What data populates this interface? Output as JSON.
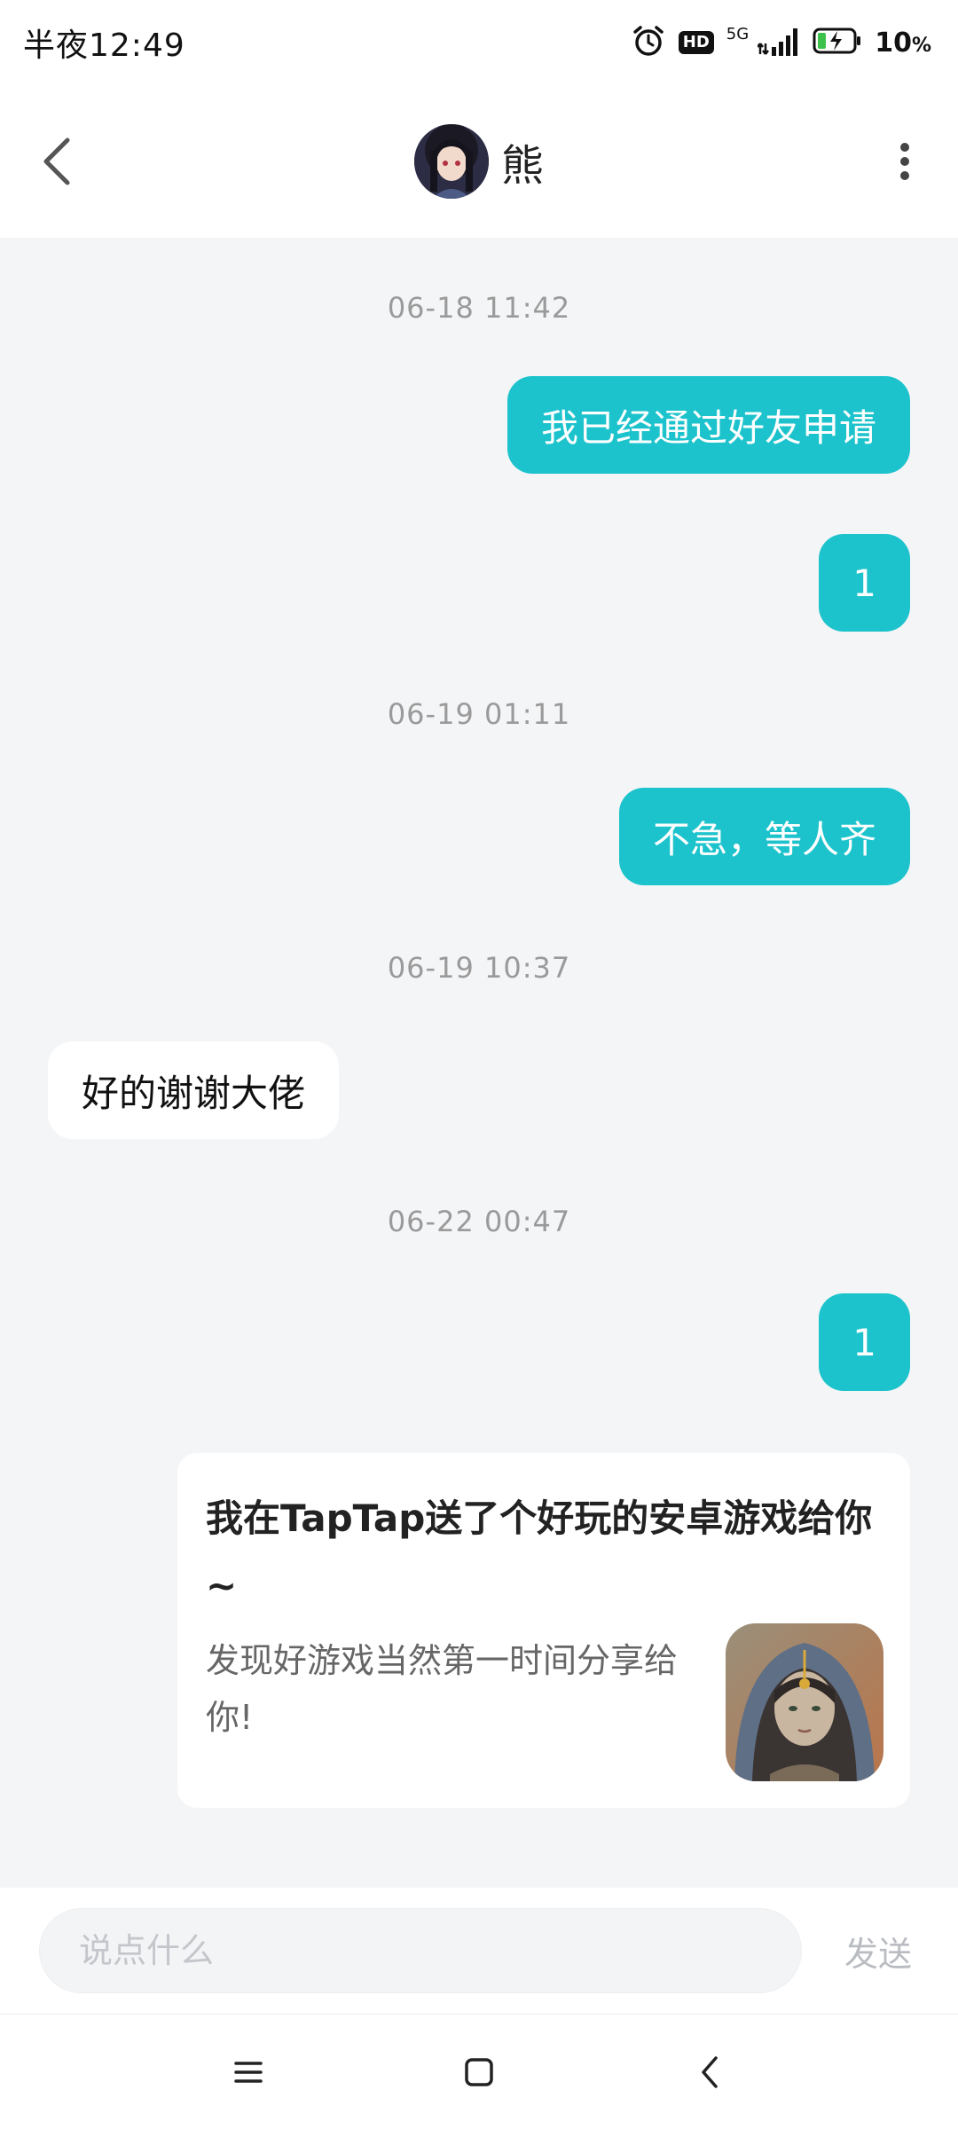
{
  "status_bar": {
    "time": "半夜12:49",
    "network": "5G",
    "hd": "HD",
    "battery_value": "10",
    "battery_unit": "%"
  },
  "header": {
    "title": "熊",
    "back_icon": "chevron-left-icon",
    "more_icon": "more-vertical-icon"
  },
  "messages": [
    {
      "type": "timestamp",
      "text": "06-18 11:42"
    },
    {
      "type": "outgoing",
      "text": "我已经通过好友申请"
    },
    {
      "type": "outgoing",
      "text": "1"
    },
    {
      "type": "timestamp",
      "text": "06-19 01:11"
    },
    {
      "type": "outgoing",
      "text": "不急，等人齐"
    },
    {
      "type": "timestamp",
      "text": "06-19 10:37"
    },
    {
      "type": "incoming",
      "text": "好的谢谢大佬"
    },
    {
      "type": "timestamp",
      "text": "06-22 00:47"
    },
    {
      "type": "outgoing",
      "text": "1"
    }
  ],
  "share_card": {
    "title": "我在TapTap送了个好玩的安卓游戏给你~",
    "description": "发现好游戏当然第一时间分享给你!"
  },
  "input_bar": {
    "placeholder": "说点什么",
    "value": "",
    "send_label": "发送"
  },
  "colors": {
    "accent": "#1cc3cc",
    "chat_background": "#f4f5f7"
  }
}
